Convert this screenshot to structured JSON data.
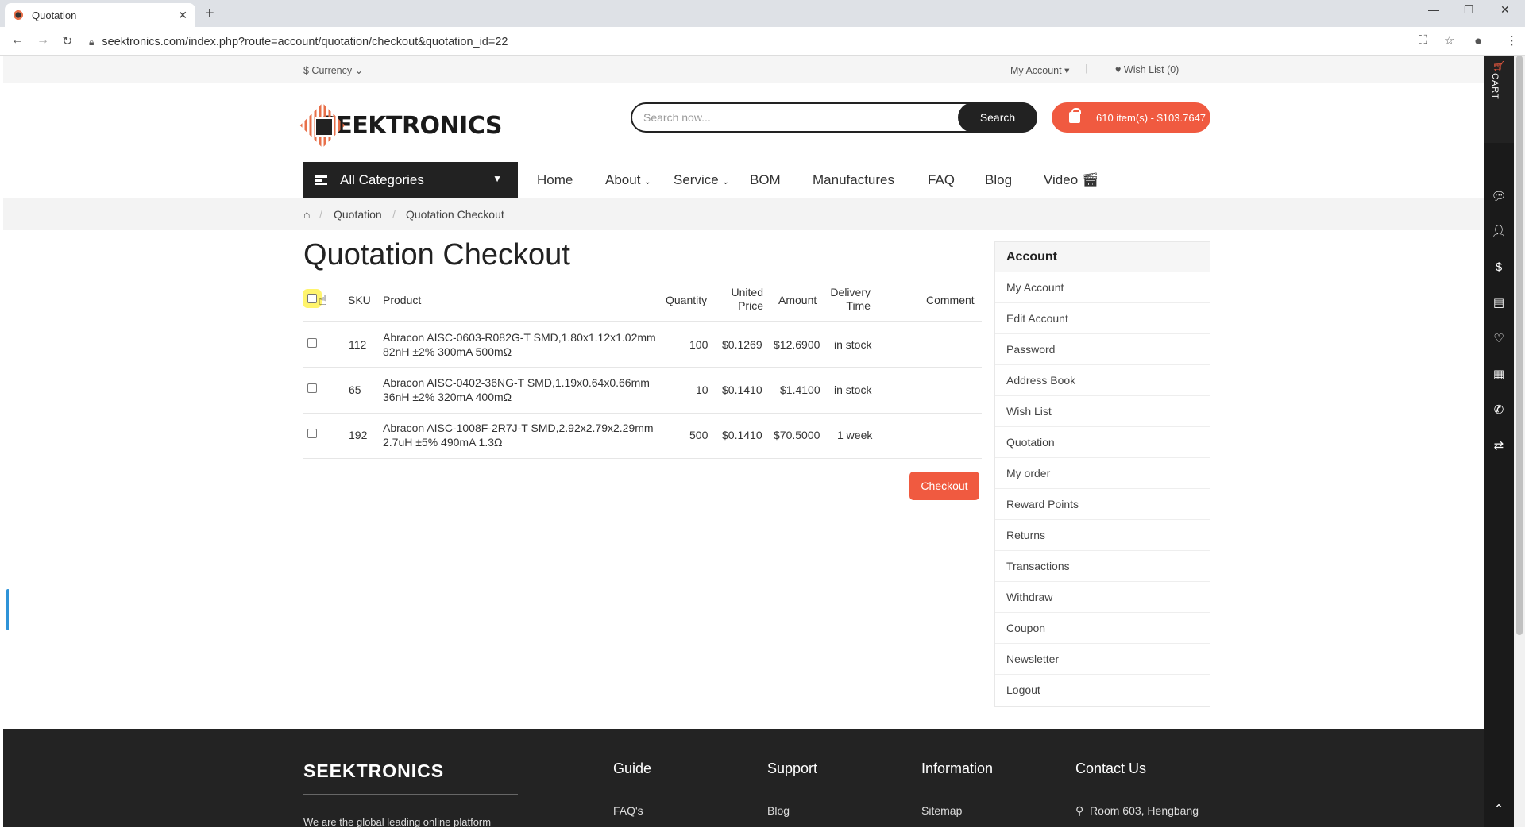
{
  "browser": {
    "tab_title": "Quotation",
    "new_tab": "+",
    "url": "seektronics.com/index.php?route=account/quotation/checkout&quotation_id=22"
  },
  "topbar": {
    "currency": "$ Currency ⌄",
    "my_account": "My Account ▾",
    "wishlist": "♥ Wish List (0)"
  },
  "header": {
    "logo_text": "SEEKTRONICS",
    "search_placeholder": "Search now...",
    "search_button": "Search",
    "cart_summary": "610 item(s) - $103.7647"
  },
  "nav": {
    "all_categories": "All Categories",
    "links": [
      "Home",
      "About",
      "Service",
      "BOM",
      "Manufactures",
      "FAQ",
      "Blog",
      "Video"
    ]
  },
  "breadcrumb": [
    "Quotation",
    "Quotation Checkout"
  ],
  "page_title": "Quotation Checkout",
  "table": {
    "headers": {
      "sku": "SKU",
      "product": "Product",
      "quantity": "Quantity",
      "price_1": "United",
      "price_2": "Price",
      "amount": "Amount",
      "delivery_1": "Delivery",
      "delivery_2": "Time",
      "comment": "Comment"
    },
    "rows": [
      {
        "sku": "112",
        "product_1": "Abracon AISC-0603-R082G-T SMD,1.80x1.12x1.02mm",
        "product_2": "82nH ±2% 300mA 500mΩ",
        "quantity": "100",
        "price": "$0.1269",
        "amount": "$12.6900",
        "delivery": "in stock"
      },
      {
        "sku": "65",
        "product_1": "Abracon AISC-0402-36NG-T SMD,1.19x0.64x0.66mm",
        "product_2": "36nH ±2% 320mA 400mΩ",
        "quantity": "10",
        "price": "$0.1410",
        "amount": "$1.4100",
        "delivery": "in stock"
      },
      {
        "sku": "192",
        "product_1": "Abracon AISC-1008F-2R7J-T SMD,2.92x2.79x2.29mm",
        "product_2": "2.7uH ±5% 490mA 1.3Ω",
        "quantity": "500",
        "price": "$0.1410",
        "amount": "$70.5000",
        "delivery": "1 week"
      }
    ]
  },
  "checkout_button": "Checkout",
  "sidebar": {
    "title": "Account",
    "items": [
      "My Account",
      "Edit Account",
      "Password",
      "Address Book",
      "Wish List",
      "Quotation",
      "My order",
      "Reward Points",
      "Returns",
      "Transactions",
      "Withdraw",
      "Coupon",
      "Newsletter",
      "Logout"
    ]
  },
  "footer": {
    "brand": "SEEKTRONICS",
    "desc": "We are the global leading online platform",
    "columns": [
      {
        "title": "Guide",
        "first": "FAQ's"
      },
      {
        "title": "Support",
        "first": "Blog"
      },
      {
        "title": "Information",
        "first": "Sitemap"
      },
      {
        "title": "Contact Us",
        "first": "Room 603, Hengbang"
      }
    ]
  },
  "right_toolbar": {
    "cart_label": "CART"
  },
  "colors": {
    "accent": "#f05a40",
    "dark": "#222222",
    "footer_bg": "#232323"
  }
}
